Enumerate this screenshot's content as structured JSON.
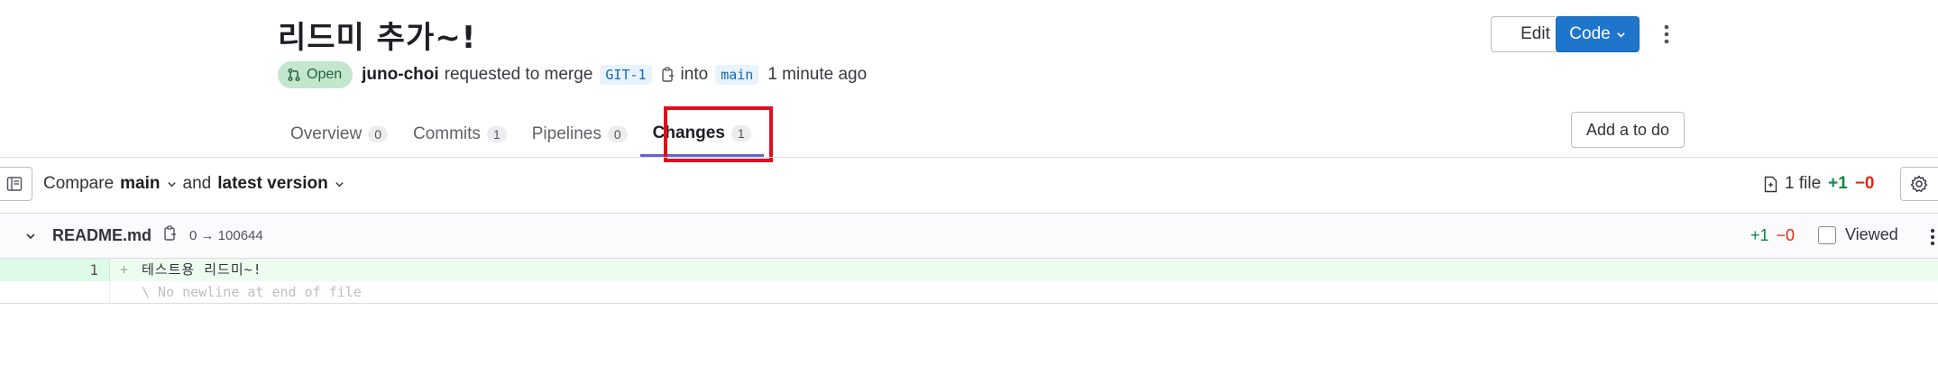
{
  "merge_request": {
    "title": "리드미 추가~!",
    "status": "Open",
    "author": "juno-choi",
    "action_text": "requested to merge",
    "source_branch": "GIT-1",
    "into_text": "into",
    "target_branch": "main",
    "time_ago": "1 minute ago"
  },
  "header_actions": {
    "edit_label": "Edit",
    "code_label": "Code"
  },
  "tabs": [
    {
      "label": "Overview",
      "count": "0"
    },
    {
      "label": "Commits",
      "count": "1"
    },
    {
      "label": "Pipelines",
      "count": "0"
    },
    {
      "label": "Changes",
      "count": "1",
      "active": true
    }
  ],
  "todo_label": "Add a to do",
  "compare": {
    "compare_label": "Compare",
    "base": "main",
    "and_label": "and",
    "head": "latest version"
  },
  "summary": {
    "files": "1 file",
    "added": "+1",
    "removed": "−0"
  },
  "file": {
    "name": "README.md",
    "mode": "0 → 100644",
    "added": "+1",
    "removed": "−0",
    "viewed_label": "Viewed"
  },
  "diff": {
    "line_number": "1",
    "sign": "+",
    "text": "테스트용 리드미~!",
    "note": "\\ No newline at end of file"
  },
  "colors": {
    "primary": "#1f75cb",
    "added": "#108548",
    "removed": "#dd2b0e",
    "highlight": "#e0101e",
    "active_tab_underline": "#6366d0"
  }
}
